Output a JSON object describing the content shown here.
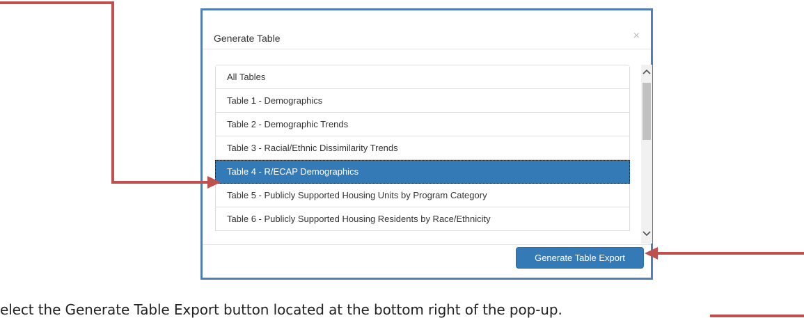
{
  "modal": {
    "title": "Generate Table",
    "close_glyph": "×",
    "items": [
      {
        "label": "All Tables",
        "active": false
      },
      {
        "label": "Table 1 - Demographics",
        "active": false
      },
      {
        "label": "Table 2 - Demographic Trends",
        "active": false
      },
      {
        "label": "Table 3 - Racial/Ethnic Dissimilarity Trends",
        "active": false
      },
      {
        "label": "Table 4 - R/ECAP Demographics",
        "active": true
      },
      {
        "label": "Table 5 - Publicly Supported Housing Units by Program Category",
        "active": false
      },
      {
        "label": "Table 6 - Publicly Supported Housing Residents by Race/Ethnicity",
        "active": false
      }
    ],
    "export_button": "Generate Table Export"
  },
  "caption": "elect the Generate Table Export button located at the bottom right of the pop-up.",
  "colors": {
    "annotation_arrow": "#c0504d",
    "modal_border": "#4f7fba",
    "active_item": "#337ab7"
  },
  "icons": {
    "scroll_up": "chevron-up-icon",
    "scroll_down": "chevron-down-icon"
  }
}
